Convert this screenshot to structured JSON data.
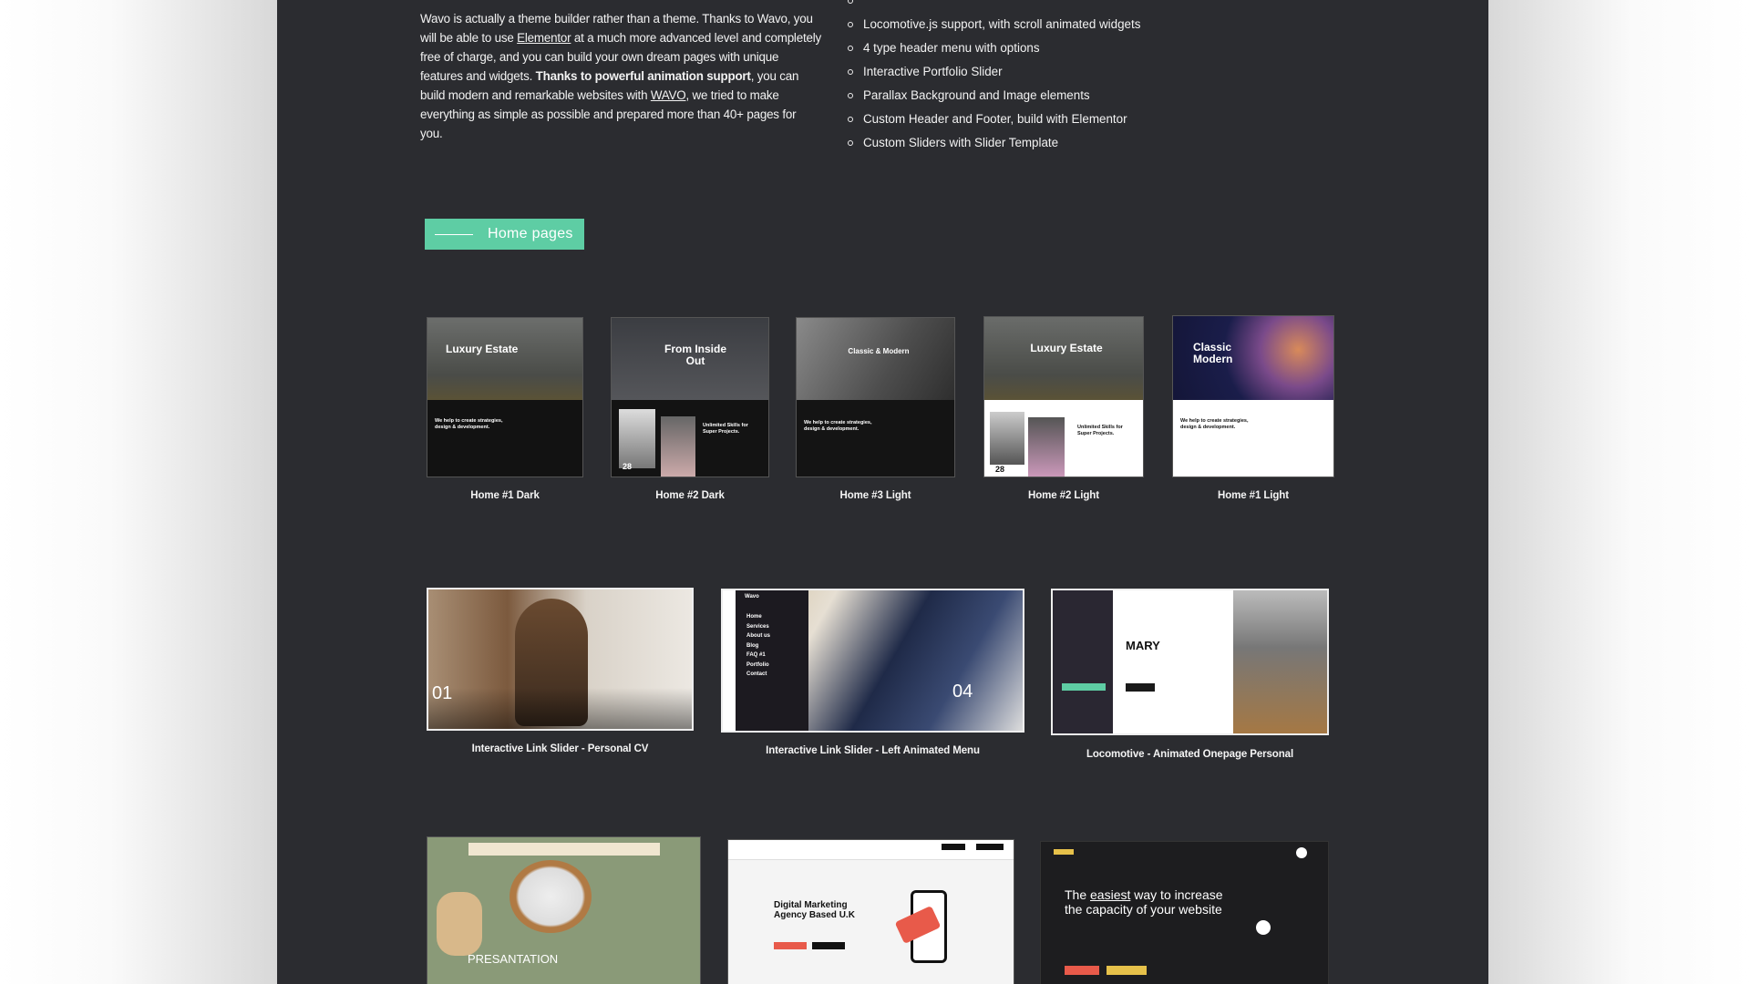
{
  "intro": {
    "p1": "Wavo is actually a theme builder rather than a theme. Thanks to Wavo, you will be able to use ",
    "link1": "Elementor",
    "p2": " at a much more advanced level and completely free of charge, and you can build your own dream pages with unique features and widgets. ",
    "bold": "Thanks to powerful animation support",
    "p3": ", you can build modern and remarkable websites with ",
    "link2": "WAVO",
    "p4": ", we tried to make everything as simple as possible and prepared more than 40+ pages for you."
  },
  "features": [
    "Locomotive.js support, with scroll animated widgets",
    "4 type header menu with options",
    "Interactive Portfolio Slider",
    "Parallax Background and Image elements",
    "Custom Header and Footer, build with Elementor",
    "Custom Sliders with Slider Template"
  ],
  "section_badge": "Home pages",
  "colors": {
    "accent": "#5ecda4",
    "panel": "#2b2c30"
  },
  "row1": [
    {
      "label": "Home #1 Dark",
      "headline": "Luxury Estate",
      "sub": "We help to create strategies, design & development."
    },
    {
      "label": "Home #2 Dark",
      "headline": "From Inside Out",
      "sub": "Unlimited Skills for Super Projects.",
      "num": "28"
    },
    {
      "label": "Home #3 Light",
      "headline": "Classic & Modern",
      "sub": "We help to create strategies, design & development."
    },
    {
      "label": "Home #2 Light",
      "headline": "Luxury Estate",
      "sub": "Unlimited Skills for Super Projects.",
      "num": "28"
    },
    {
      "label": "Home #1 Light",
      "headline": "Classic Modern",
      "sub": "We help to create strategies, design & development."
    }
  ],
  "row2": [
    {
      "label": "Interactive Link Slider - Personal CV",
      "num": "01"
    },
    {
      "label": "Interactive Link Slider - Left Animated Menu",
      "num": "04",
      "menu": [
        "Home",
        "Services",
        "About us",
        "Blog",
        "FAQ #1",
        "Portfolio",
        "Contact"
      ],
      "brand": "Wavo"
    },
    {
      "label": "Locomotive - Animated Onepage Personal",
      "name": "MARY"
    }
  ],
  "row3": [
    {
      "headline": "PRESANTATION"
    },
    {
      "headline": "Digital Marketing Agency Based U.K"
    },
    {
      "headline_pre": "The ",
      "headline_em": "easiest",
      "headline_post": " way to increase the capacity of your website"
    }
  ]
}
